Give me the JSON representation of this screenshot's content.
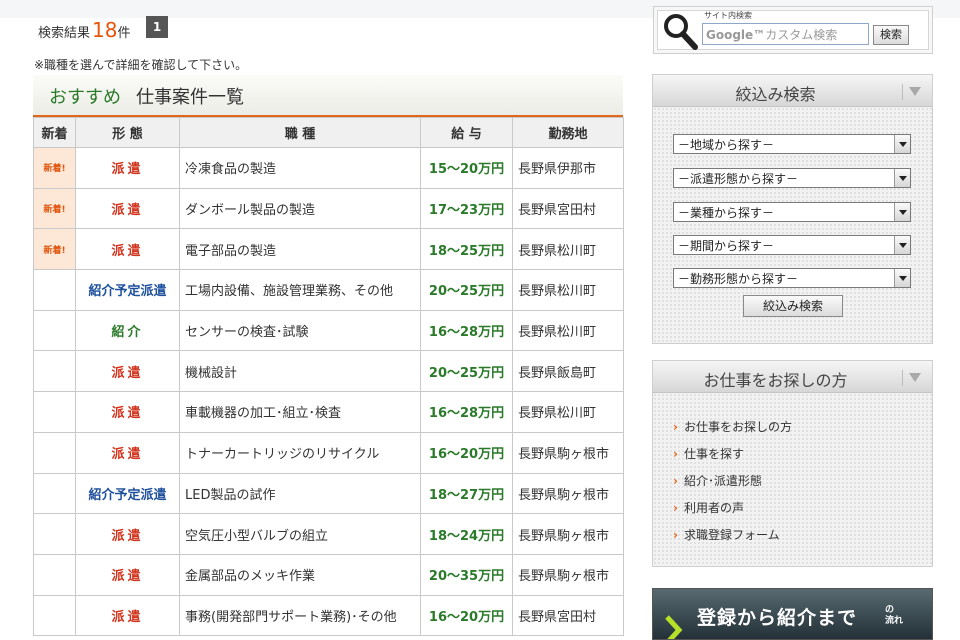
{
  "results": {
    "label": "検索結果",
    "count": "18",
    "unit": "件",
    "page": "1"
  },
  "notice": "※職種を選んで詳細を確認して下さい。",
  "list_title": {
    "highlight": "おすすめ",
    "text": "仕事案件一覧"
  },
  "table": {
    "headers": [
      "新着",
      "形 態",
      "職 種",
      "給 与",
      "勤務地"
    ],
    "rows": [
      {
        "new": "新着!",
        "type": "派遣",
        "type_class": "t-haken",
        "job": "冷凍食品の製造",
        "salary": "15～20万円",
        "location": "長野県伊那市"
      },
      {
        "new": "新着!",
        "type": "派遣",
        "type_class": "t-haken",
        "job": "ダンボール製品の製造",
        "salary": "17～23万円",
        "location": "長野県宮田村"
      },
      {
        "new": "新着!",
        "type": "派遣",
        "type_class": "t-haken",
        "job": "電子部品の製造",
        "salary": "18～25万円",
        "location": "長野県松川町"
      },
      {
        "new": "",
        "type": "紹介予定派遣",
        "type_class": "t-yotei",
        "job": "工場内設備、施設管理業務、その他",
        "salary": "20～25万円",
        "location": "長野県松川町"
      },
      {
        "new": "",
        "type": "紹介",
        "type_class": "t-shokai",
        "job": "センサーの検査･試験",
        "salary": "16～28万円",
        "location": "長野県松川町"
      },
      {
        "new": "",
        "type": "派遣",
        "type_class": "t-haken",
        "job": "機械設計",
        "salary": "20～25万円",
        "location": "長野県飯島町"
      },
      {
        "new": "",
        "type": "派遣",
        "type_class": "t-haken",
        "job": "車載機器の加工･組立･検査",
        "salary": "16～28万円",
        "location": "長野県松川町"
      },
      {
        "new": "",
        "type": "派遣",
        "type_class": "t-haken",
        "job": "トナーカートリッジのリサイクル",
        "salary": "16～20万円",
        "location": "長野県駒ヶ根市"
      },
      {
        "new": "",
        "type": "紹介予定派遣",
        "type_class": "t-yotei",
        "job": "LED製品の試作",
        "salary": "18～27万円",
        "location": "長野県駒ヶ根市"
      },
      {
        "new": "",
        "type": "派遣",
        "type_class": "t-haken",
        "job": "空気圧小型バルブの組立",
        "salary": "18～24万円",
        "location": "長野県駒ヶ根市"
      },
      {
        "new": "",
        "type": "派遣",
        "type_class": "t-haken",
        "job": "金属部品のメッキ作業",
        "salary": "20～35万円",
        "location": "長野県駒ヶ根市"
      },
      {
        "new": "",
        "type": "派遣",
        "type_class": "t-haken",
        "job": "事務(開発部門サポート業務)･その他",
        "salary": "16～20万円",
        "location": "長野県宮田村"
      }
    ]
  },
  "site_search": {
    "label": "サイト内検索",
    "placeholder_brand": "Google™",
    "placeholder": "カスタム検索",
    "button": "検索"
  },
  "filter_panel": {
    "title": "絞込み検索",
    "selects": [
      "－地域から探す－",
      "－派遣形態から探す－",
      "－業種から探す－",
      "－期間から探す－",
      "－勤務形態から探す－"
    ],
    "button": "絞込み検索"
  },
  "job_seeker_panel": {
    "title": "お仕事をお探しの方",
    "links": [
      "お仕事をお探しの方",
      "仕事を探す",
      "紹介･派遣形態",
      "利用者の声",
      "求職登録フォーム"
    ]
  },
  "banner": {
    "text": "登録から紹介まで",
    "suffix_1": "の",
    "suffix_2": "流れ"
  },
  "colors": {
    "accent_orange": "#e2661c",
    "green": "#2a7a2a",
    "red": "#d2321c",
    "blue": "#1d4f9c"
  }
}
